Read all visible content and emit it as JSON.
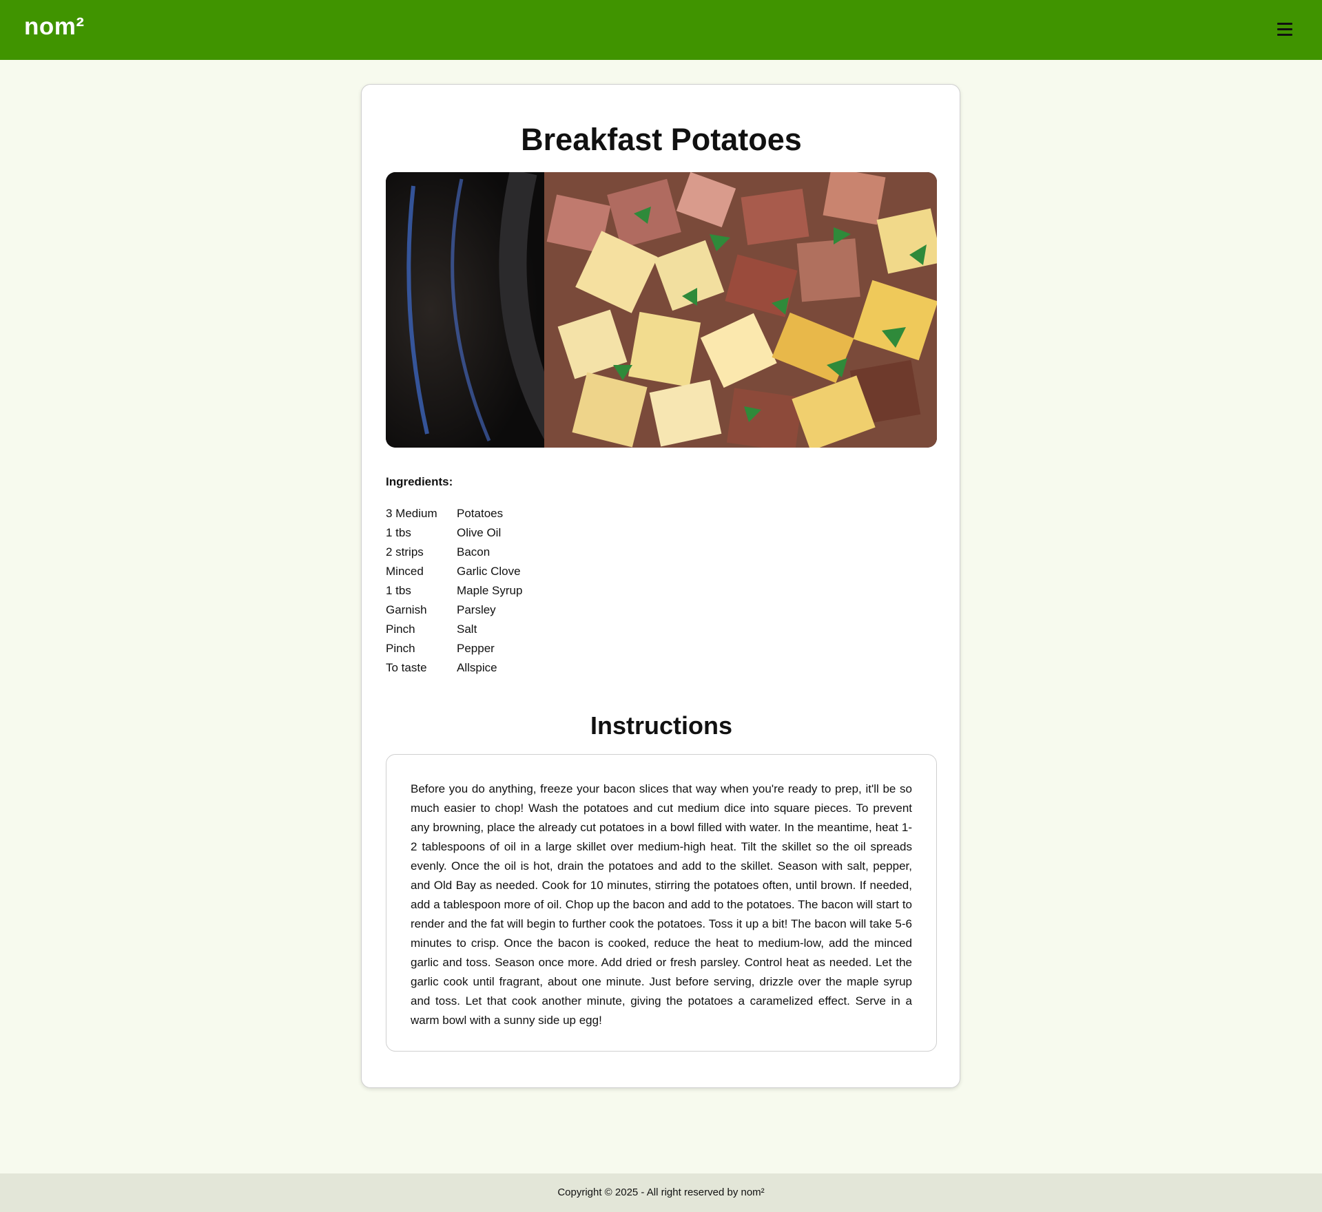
{
  "header": {
    "brand": "nom²",
    "menu_icon": "hamburger-menu-icon"
  },
  "recipe": {
    "title": "Breakfast Potatoes",
    "image_alt": "Skillet of diced breakfast potatoes with bacon and parsley",
    "ingredients_label": "Ingredients:",
    "ingredients": [
      {
        "qty": "3 Medium",
        "name": "Potatoes"
      },
      {
        "qty": "1 tbs",
        "name": "Olive Oil"
      },
      {
        "qty": "2 strips",
        "name": "Bacon"
      },
      {
        "qty": "Minced",
        "name": "Garlic Clove"
      },
      {
        "qty": "1 tbs",
        "name": "Maple Syrup"
      },
      {
        "qty": "Garnish",
        "name": "Parsley"
      },
      {
        "qty": "Pinch",
        "name": "Salt"
      },
      {
        "qty": "Pinch",
        "name": "Pepper"
      },
      {
        "qty": "To taste",
        "name": "Allspice"
      }
    ],
    "instructions_title": "Instructions",
    "instructions": "Before you do anything, freeze your bacon slices that way when you're ready to prep, it'll be so much easier to chop! Wash the potatoes and cut medium dice into square pieces. To prevent any browning, place the already cut potatoes in a bowl filled with water. In the meantime, heat 1-2 tablespoons of oil in a large skillet over medium-high heat. Tilt the skillet so the oil spreads evenly. Once the oil is hot, drain the potatoes and add to the skillet. Season with salt, pepper, and Old Bay as needed. Cook for 10 minutes, stirring the potatoes often, until brown. If needed, add a tablespoon more of oil. Chop up the bacon and add to the potatoes. The bacon will start to render and the fat will begin to further cook the potatoes. Toss it up a bit! The bacon will take 5-6 minutes to crisp. Once the bacon is cooked, reduce the heat to medium-low, add the minced garlic and toss. Season once more. Add dried or fresh parsley. Control heat as needed. Let the garlic cook until fragrant, about one minute. Just before serving, drizzle over the maple syrup and toss. Let that cook another minute, giving the potatoes a caramelized effect. Serve in a warm bowl with a sunny side up egg!"
  },
  "footer": {
    "copyright": "Copyright © 2025 - All right reserved by nom²"
  },
  "colors": {
    "header_bg": "#409400",
    "page_bg": "#f7faee",
    "footer_bg": "#e3e6d8"
  }
}
